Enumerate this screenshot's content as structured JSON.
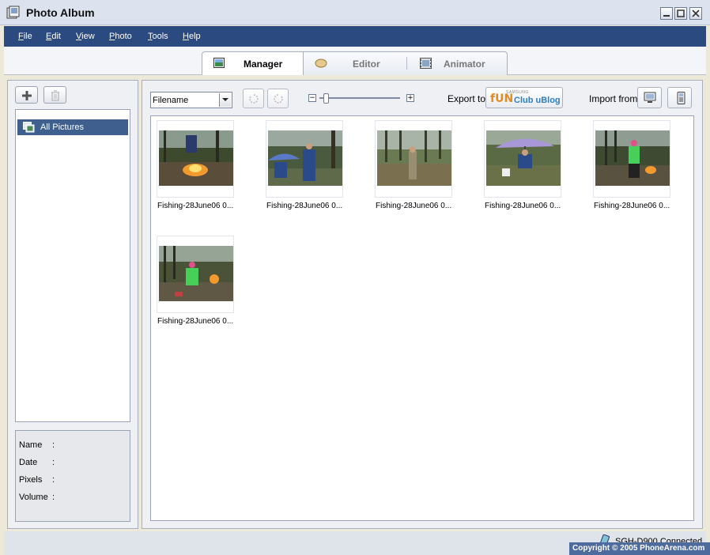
{
  "window": {
    "title": "Photo Album"
  },
  "menu": [
    {
      "pre": "",
      "ul": "F",
      "post": "ile"
    },
    {
      "pre": "",
      "ul": "E",
      "post": "dit"
    },
    {
      "pre": "",
      "ul": "V",
      "post": "iew"
    },
    {
      "pre": "",
      "ul": "P",
      "post": "hoto"
    },
    {
      "pre": "",
      "ul": "T",
      "post": "ools"
    },
    {
      "pre": "",
      "ul": "H",
      "post": "elp"
    }
  ],
  "tabs": [
    {
      "label": "Manager",
      "active": true,
      "icon": "manager-icon"
    },
    {
      "label": "Editor",
      "active": false,
      "icon": "editor-icon"
    },
    {
      "label": "Animator",
      "active": false,
      "icon": "animator-icon"
    }
  ],
  "left": {
    "tree_item": "All Pictures",
    "info": [
      {
        "key": "Name",
        "colon": ":"
      },
      {
        "key": "Date",
        "colon": ":"
      },
      {
        "key": "Pixels",
        "colon": ":"
      },
      {
        "key": "Volume",
        "colon": ":"
      }
    ]
  },
  "toolbar": {
    "sort_value": "Filename",
    "export_label": "Export to",
    "brand_small": "SAMSUNG",
    "brand_fun": "fUN",
    "brand_blog": "Club uBlog",
    "import_label": "Import from"
  },
  "photos": [
    {
      "caption": "Fishing-28June06 0..."
    },
    {
      "caption": "Fishing-28June06 0..."
    },
    {
      "caption": "Fishing-28June06 0..."
    },
    {
      "caption": "Fishing-28June06 0..."
    },
    {
      "caption": "Fishing-28June06 0..."
    },
    {
      "caption": "Fishing-28June06 0..."
    }
  ],
  "status": {
    "text": "SGH-D900 Connected",
    "copyright": "Copyright © 2005 PhoneArena.com"
  },
  "colors": {
    "menubar": "#2b4a7f",
    "selection": "#3f5f8f"
  }
}
